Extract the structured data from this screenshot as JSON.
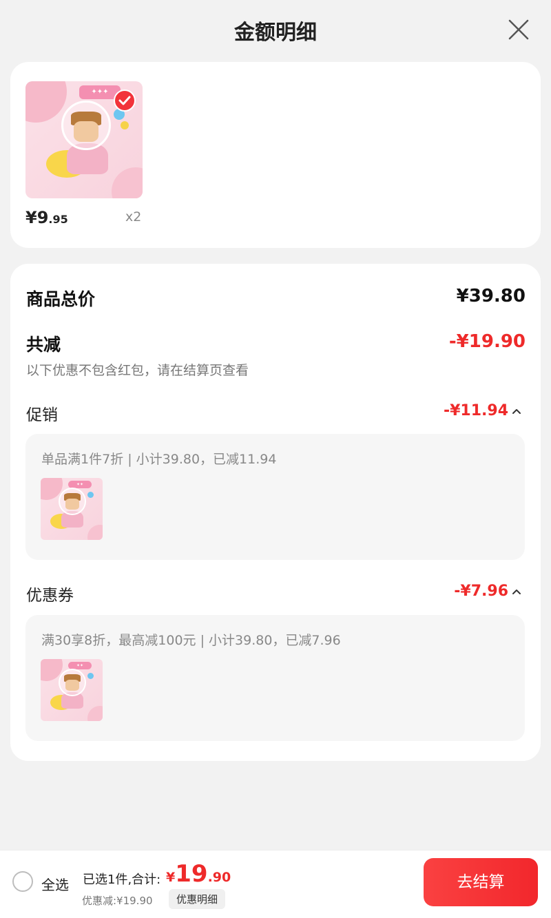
{
  "header": {
    "title": "金额明细",
    "close_icon": "close-icon"
  },
  "product": {
    "price_int": "¥9",
    "price_dec": ".95",
    "quantity": "x2",
    "selected": true,
    "check_icon": "check-circle-icon"
  },
  "summary": {
    "total_label": "商品总价",
    "total_value": "¥39.80",
    "reduce_label": "共减",
    "reduce_value": "-¥19.90",
    "note": "以下优惠不包含红包，请在结算页查看"
  },
  "promotion": {
    "label": "促销",
    "value": "-¥11.94",
    "detail": "单品满1件7折 | 小计39.80，已减11.94",
    "expand_icon": "chevron-up-icon"
  },
  "coupon": {
    "label": "优惠券",
    "value": "-¥7.96",
    "detail": "满30享8折，最高减100元 | 小计39.80，已减7.96",
    "expand_icon": "chevron-up-icon"
  },
  "footer": {
    "select_all": "全选",
    "selected_count": "已选1件,合计:",
    "total_currency": "¥",
    "total_int": "19",
    "total_dec": ".90",
    "discount": "优惠减:¥19.90",
    "detail_button": "优惠明细",
    "checkout_button": "去结算"
  },
  "colors": {
    "accent": "#ee2a2a",
    "checkout_bg": "#f2272c",
    "card_bg": "#ffffff",
    "page_bg": "#f2f2f2"
  }
}
